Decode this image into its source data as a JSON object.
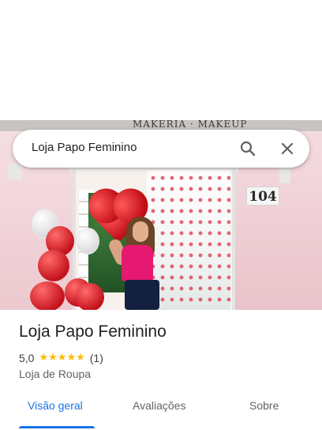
{
  "search": {
    "query": "Loja Papo Feminino",
    "search_icon": "search-icon",
    "close_icon": "close-icon"
  },
  "photo": {
    "sign_text": "MAKERIA · MAKEUP",
    "number_plate": "104"
  },
  "place": {
    "title": "Loja Papo Feminino",
    "rating": "5,0",
    "stars": 5,
    "review_count": "(1)",
    "category": "Loja de Roupa"
  },
  "tabs": [
    {
      "label": "Visão geral",
      "active": true
    },
    {
      "label": "Avaliações",
      "active": false
    },
    {
      "label": "Sobre",
      "active": false
    }
  ],
  "colors": {
    "accent": "#1a73e8",
    "star": "#fbbc04",
    "text_primary": "#202124",
    "text_secondary": "#5f6368"
  }
}
